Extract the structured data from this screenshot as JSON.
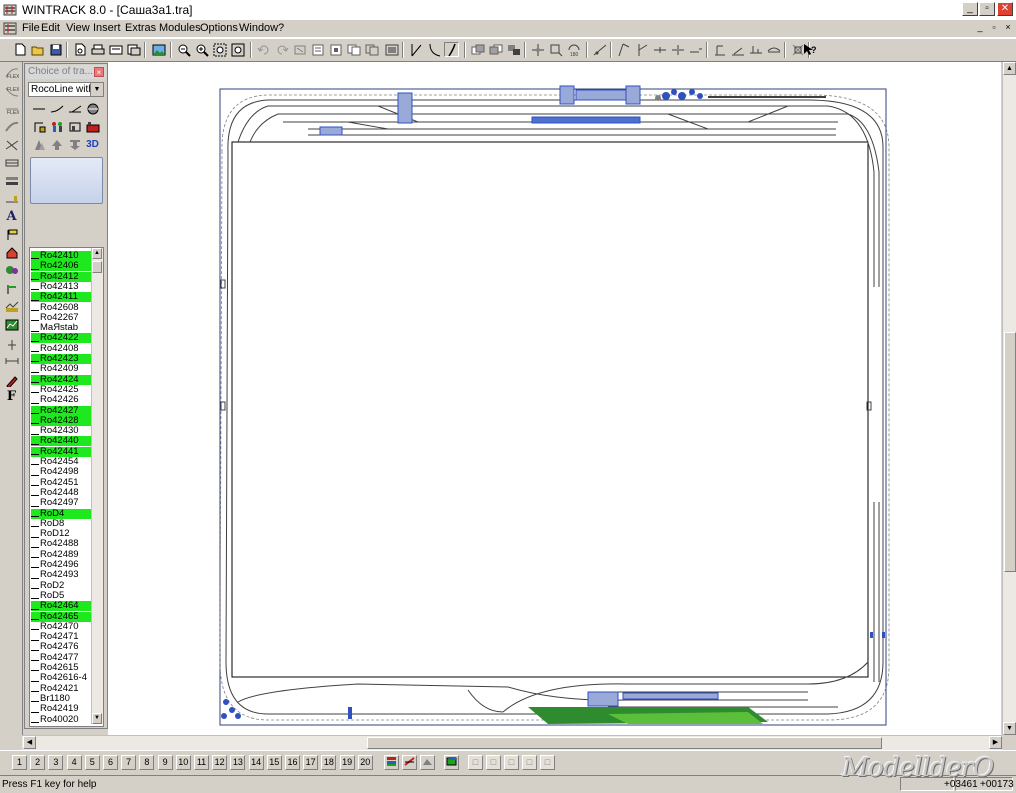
{
  "window": {
    "title": "WINTRACK 8.0 - [Саша3а1.tra]",
    "minimize": "_",
    "maximize": "▫",
    "close": "✕"
  },
  "menu": {
    "items": [
      "File",
      "Edit",
      "View",
      "Insert",
      "Extras",
      "Modules",
      "Options",
      "Window",
      "?"
    ],
    "mdi_minimize": "_",
    "mdi_restore": "▫",
    "mdi_close": "×"
  },
  "panel": {
    "title": "Choice of tra...",
    "track_system": "RocoLine witho",
    "parts": [
      {
        "id": "Ro42410",
        "hl": true
      },
      {
        "id": "Ro42406",
        "hl": true
      },
      {
        "id": "Ro42412",
        "hl": true
      },
      {
        "id": "Ro42413",
        "hl": false
      },
      {
        "id": "Ro42411",
        "hl": true
      },
      {
        "id": "Ro42608",
        "hl": false
      },
      {
        "id": "Ro42267",
        "hl": false
      },
      {
        "id": "MaЯstab",
        "hl": false
      },
      {
        "id": "Ro42422",
        "hl": true
      },
      {
        "id": "Ro42408",
        "hl": false
      },
      {
        "id": "Ro42423",
        "hl": true
      },
      {
        "id": "Ro42409",
        "hl": false
      },
      {
        "id": "Ro42424",
        "hl": true
      },
      {
        "id": "Ro42425",
        "hl": false
      },
      {
        "id": "Ro42426",
        "hl": false
      },
      {
        "id": "Ro42427",
        "hl": true
      },
      {
        "id": "Ro42428",
        "hl": true
      },
      {
        "id": "Ro42430",
        "hl": false
      },
      {
        "id": "Ro42440",
        "hl": true
      },
      {
        "id": "Ro42441",
        "hl": true
      },
      {
        "id": "Ro42454",
        "hl": false
      },
      {
        "id": "Ro42498",
        "hl": false
      },
      {
        "id": "Ro42451",
        "hl": false
      },
      {
        "id": "Ro42448",
        "hl": false
      },
      {
        "id": "Ro42497",
        "hl": false
      },
      {
        "id": "RoD4",
        "hl": true
      },
      {
        "id": "RoD8",
        "hl": false
      },
      {
        "id": "RoD12",
        "hl": false
      },
      {
        "id": "Ro42488",
        "hl": false
      },
      {
        "id": "Ro42489",
        "hl": false
      },
      {
        "id": "Ro42496",
        "hl": false
      },
      {
        "id": "Ro42493",
        "hl": false
      },
      {
        "id": "RoD2",
        "hl": false
      },
      {
        "id": "RoD5",
        "hl": false
      },
      {
        "id": "Ro42464",
        "hl": true
      },
      {
        "id": "Ro42465",
        "hl": true
      },
      {
        "id": "Ro42470",
        "hl": false
      },
      {
        "id": "Ro42471",
        "hl": false
      },
      {
        "id": "Ro42476",
        "hl": false
      },
      {
        "id": "Ro42477",
        "hl": false
      },
      {
        "id": "Ro42615",
        "hl": false
      },
      {
        "id": "Ro42616-4",
        "hl": false
      },
      {
        "id": "Ro42421",
        "hl": false
      },
      {
        "id": "Br1180",
        "hl": false
      },
      {
        "id": "Ro42419",
        "hl": false
      },
      {
        "id": "Ro40020",
        "hl": false
      }
    ],
    "tool_3d": "3D"
  },
  "left_tools": {
    "text_tool": "A",
    "font_tool": "F"
  },
  "modules": {
    "buttons": [
      "1",
      "2",
      "3",
      "4",
      "5",
      "6",
      "7",
      "8",
      "9",
      "10",
      "11",
      "12",
      "13",
      "14",
      "15",
      "16",
      "17",
      "18",
      "19",
      "20"
    ]
  },
  "status": {
    "message": "Press F1 key for help",
    "coord_x": "+03461",
    "coord_y": "+00173"
  },
  "watermark": "ModellderO",
  "colors": {
    "highlight": "#1ee81e",
    "track": "#404040",
    "buildings": "#3050c0",
    "grass": "#2e8b2e"
  }
}
